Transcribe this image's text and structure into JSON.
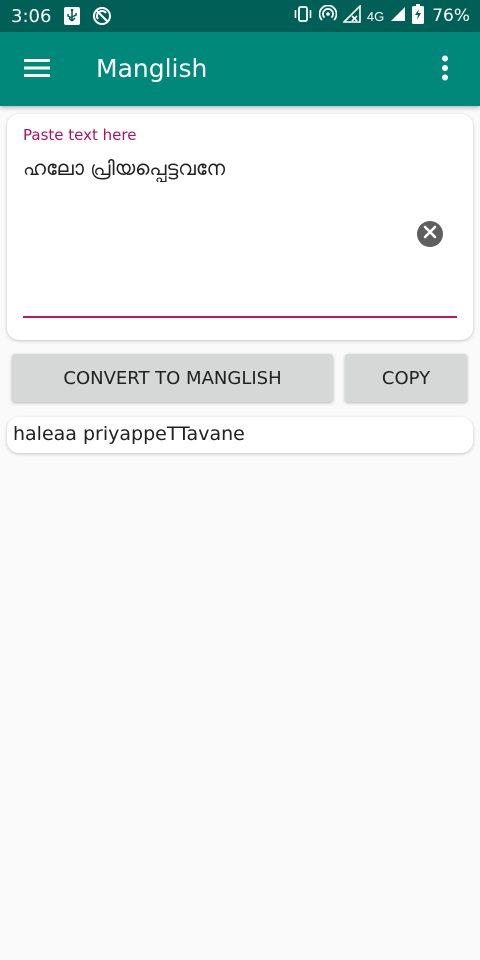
{
  "status_bar": {
    "time": "3:06",
    "network_label": "4G",
    "battery_percent": "76%",
    "background": "#005f56"
  },
  "app_bar": {
    "title": "Manglish",
    "background": "#00897b",
    "menu_icon": "hamburger-menu-icon",
    "overflow_icon": "more-vert-icon"
  },
  "input": {
    "label": "Paste text here",
    "value": "ഹലോ പ്രിയപ്പെട്ടവനേ",
    "label_color": "#ad1457",
    "underline_color": "#c2185b",
    "clear_icon": "clear-circle-icon"
  },
  "actions": {
    "convert_label": "CONVERT TO MANGLISH",
    "copy_label": "COPY"
  },
  "output": {
    "text": "haleaa priyappeTTavane"
  }
}
